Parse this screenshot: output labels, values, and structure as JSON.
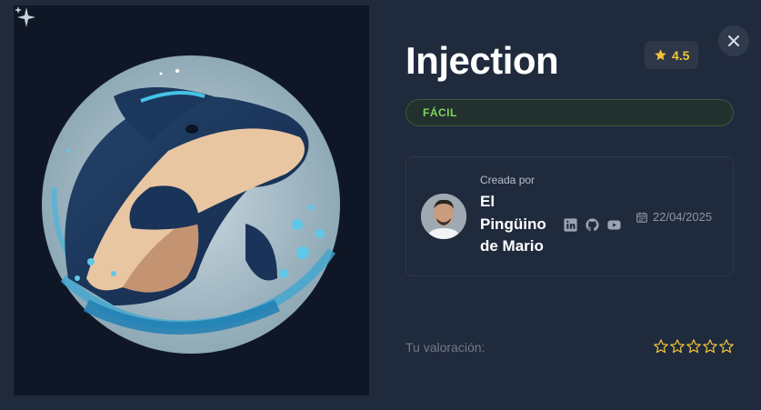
{
  "machine": {
    "title": "Injection",
    "rating": "4.5",
    "difficulty": "FÁCIL"
  },
  "author": {
    "created_label": "Creada por",
    "name": "El Pingüino de Mario",
    "date": "22/04/2025",
    "socials": [
      "linkedin-icon",
      "github-icon",
      "youtube-icon"
    ]
  },
  "user_rating": {
    "label": "Tu valoración:",
    "max_stars": 5,
    "current": 0
  },
  "colors": {
    "background": "#1f2a3c",
    "image_bg": "#0f1727",
    "star": "#f3c33a",
    "difficulty_text": "#7fd65b"
  },
  "icons": {
    "close": "close-icon",
    "rating": "star-icon",
    "date": "calendar-icon",
    "sparkle": "sparkle-icon"
  }
}
